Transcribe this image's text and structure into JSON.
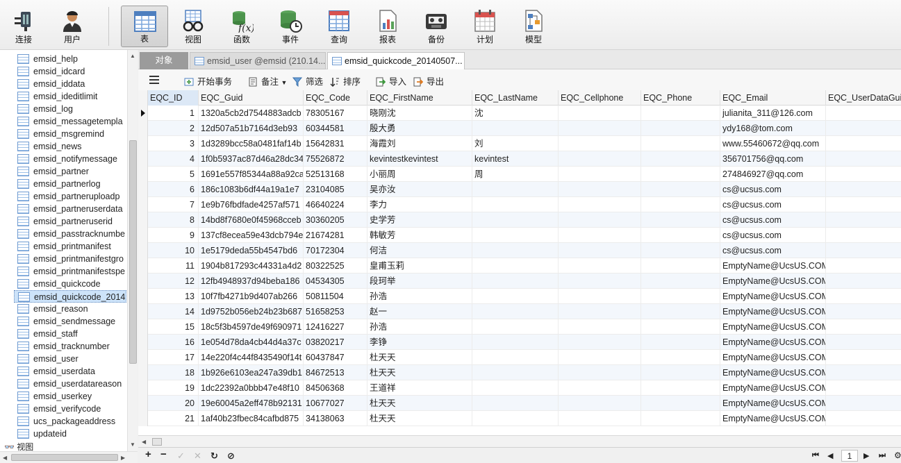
{
  "toolbar": {
    "buttons": [
      {
        "label": "连接",
        "icon": "plug-icon"
      },
      {
        "label": "用户",
        "icon": "user-icon"
      },
      {
        "label": "表",
        "icon": "table-icon"
      },
      {
        "label": "视图",
        "icon": "view-glasses-icon"
      },
      {
        "label": "函数",
        "icon": "function-icon"
      },
      {
        "label": "事件",
        "icon": "event-clock-icon"
      },
      {
        "label": "查询",
        "icon": "query-icon"
      },
      {
        "label": "报表",
        "icon": "report-icon"
      },
      {
        "label": "备份",
        "icon": "backup-tape-icon"
      },
      {
        "label": "计划",
        "icon": "calendar-icon"
      },
      {
        "label": "模型",
        "icon": "model-icon"
      }
    ],
    "active": "表"
  },
  "tree": {
    "items": [
      "emsid_help",
      "emsid_idcard",
      "emsid_iddata",
      "emsid_ideditlimit",
      "emsid_log",
      "emsid_messagetempla",
      "emsid_msgremind",
      "emsid_news",
      "emsid_notifymessage",
      "emsid_partner",
      "emsid_partnerlog",
      "emsid_partneruploadp",
      "emsid_partneruserdata",
      "emsid_partneruserid",
      "emsid_passtracknumbe",
      "emsid_printmanifest",
      "emsid_printmanifestgro",
      "emsid_printmanifestspe",
      "emsid_quickcode",
      "emsid_quickcode_2014",
      "emsid_reason",
      "emsid_sendmessage",
      "emsid_staff",
      "emsid_tracknumber",
      "emsid_user",
      "emsid_userdata",
      "emsid_userdatareason",
      "emsid_userkey",
      "emsid_verifycode",
      "ucs_packageaddress",
      "updateid"
    ],
    "selected_index": 19,
    "views_node": "视图"
  },
  "tabs": {
    "objects": "对象",
    "tab1": "emsid_user @emsid (210.14...",
    "tab2": "emsid_quickcode_20140507..."
  },
  "actions": {
    "begin_tx": "开始事务",
    "memo": "备注",
    "filter": "筛选",
    "sort": "排序",
    "import": "导入",
    "export": "导出"
  },
  "grid": {
    "columns": [
      "EQC_ID",
      "EQC_Guid",
      "EQC_Code",
      "EQC_FirstName",
      "EQC_LastName",
      "EQC_Cellphone",
      "EQC_Phone",
      "EQC_Email",
      "EQC_UserDataGuid"
    ],
    "rows": [
      [
        "1",
        "1320a5cb2d7544883adcb",
        "78305167",
        "晓刚沈",
        "沈",
        "",
        "",
        "julianita_311@126.com",
        ""
      ],
      [
        "2",
        "12d507a51b7164d3eb93",
        "60344581",
        "殷大勇",
        "",
        "",
        "",
        "ydy168@tom.com",
        ""
      ],
      [
        "3",
        "1d3289bcc58a0481faf14b",
        "15642831",
        "海霞刘",
        "刘",
        "",
        "",
        "www.55460672@qq.com",
        ""
      ],
      [
        "4",
        "1f0b5937ac87d46a28dc34",
        "75526872",
        "kevintestkevintest",
        "kevintest",
        "",
        "",
        "356701756@qq.com",
        ""
      ],
      [
        "5",
        "1691e557f85344a88a92ca",
        "52513168",
        "小丽周",
        "周",
        "",
        "",
        "274846927@qq.com",
        ""
      ],
      [
        "6",
        "186c1083b6df44a19a1e7",
        "23104085",
        "吴亦汝",
        "",
        "",
        "",
        "cs@ucsus.com",
        ""
      ],
      [
        "7",
        "1e9b76fbdfade4257af571",
        "46640224",
        "李力",
        "",
        "",
        "",
        "cs@ucsus.com",
        ""
      ],
      [
        "8",
        "14bd8f7680e0f45968cceb",
        "30360205",
        "史学芳",
        "",
        "",
        "",
        "cs@ucsus.com",
        ""
      ],
      [
        "9",
        "137cf8ecea59e43dcb794e",
        "21674281",
        "韩敏芳",
        "",
        "",
        "",
        "cs@ucsus.com",
        ""
      ],
      [
        "10",
        "1e5179deda55b4547bd6",
        "70172304",
        "何洁",
        "",
        "",
        "",
        "cs@ucsus.com",
        ""
      ],
      [
        "11",
        "1904b817293c44331a4d2",
        "80322525",
        "皇甫玉莉",
        "",
        "",
        "",
        "EmptyName@UcsUS.COM",
        ""
      ],
      [
        "12",
        "12fb4948937d94beba186",
        "04534305",
        "段珂举",
        "",
        "",
        "",
        "EmptyName@UcsUS.COM",
        ""
      ],
      [
        "13",
        "10f7fb4271b9d407ab266",
        "50811504",
        "孙浩",
        "",
        "",
        "",
        "EmptyName@UcsUS.COM",
        ""
      ],
      [
        "14",
        "1d9752b056eb24b23b687",
        "51658253",
        "赵一",
        "",
        "",
        "",
        "EmptyName@UcsUS.COM",
        ""
      ],
      [
        "15",
        "18c5f3b4597de49f690971",
        "12416227",
        "孙浩",
        "",
        "",
        "",
        "EmptyName@UcsUS.COM",
        ""
      ],
      [
        "16",
        "1e054d78da4cb44d4a37c",
        "03820217",
        "李铮",
        "",
        "",
        "",
        "EmptyName@UcsUS.COM",
        ""
      ],
      [
        "17",
        "14e220f4c44f8435490f14t",
        "60437847",
        "杜天天",
        "",
        "",
        "",
        "EmptyName@UcsUS.COM",
        ""
      ],
      [
        "18",
        "1b926e6103ea247a39db1",
        "84672513",
        "杜天天",
        "",
        "",
        "",
        "EmptyName@UcsUS.COM",
        ""
      ],
      [
        "19",
        "1dc22392a0bbb47e48f10",
        "84506368",
        "王道祥",
        "",
        "",
        "",
        "EmptyName@UcsUS.COM",
        ""
      ],
      [
        "20",
        "19e60045a2eff478b92131",
        "10677027",
        "杜天天",
        "",
        "",
        "",
        "EmptyName@UcsUS.COM",
        ""
      ],
      [
        "21",
        "1af40b23fbec84cafbd875",
        "34138063",
        "杜天天",
        "",
        "",
        "",
        "EmptyName@UcsUS.COM",
        ""
      ]
    ]
  },
  "status": {
    "page": "1"
  }
}
